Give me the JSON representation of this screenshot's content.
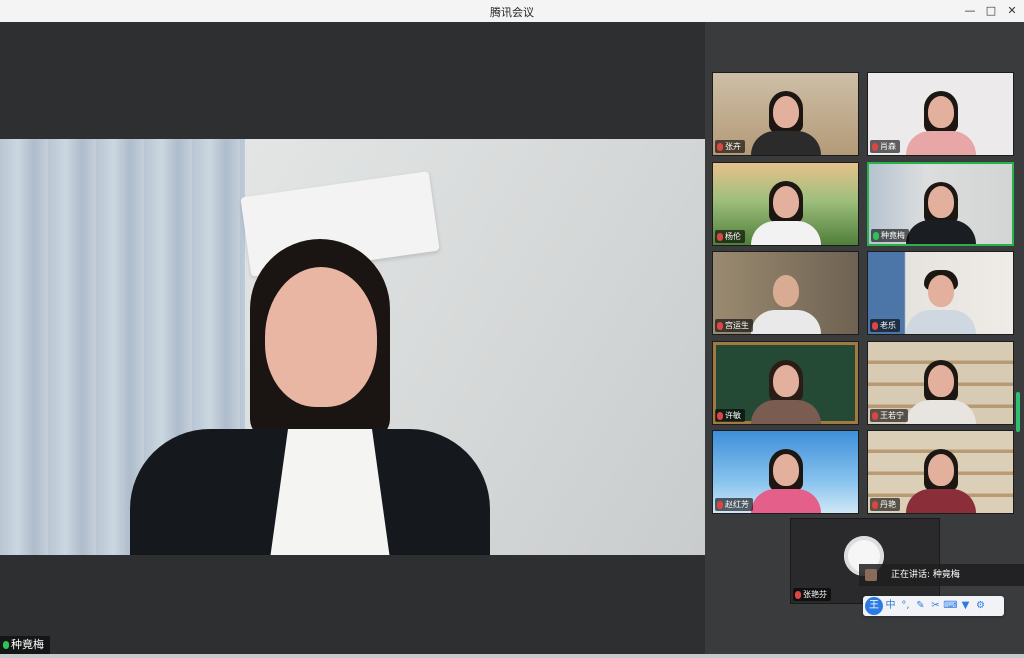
{
  "window": {
    "title": "腾讯会议",
    "controls": [
      "minimize-icon",
      "maximize-icon",
      "close-icon"
    ]
  },
  "main_speaker": {
    "name": "种竟梅",
    "mic": "on"
  },
  "participants": [
    {
      "name": "张卉",
      "mic": "muted"
    },
    {
      "name": "肖森",
      "mic": "muted",
      "host_badge": true
    },
    {
      "name": "杨伦",
      "mic": "muted"
    },
    {
      "name": "种竟梅",
      "mic": "on",
      "active_speaker": true
    },
    {
      "name": "宫运生",
      "mic": "muted"
    },
    {
      "name": "老乐",
      "mic": "muted"
    },
    {
      "name": "许敏",
      "mic": "muted"
    },
    {
      "name": "王若宁",
      "mic": "muted"
    },
    {
      "name": "赵红芳",
      "mic": "muted"
    },
    {
      "name": "丹艳",
      "mic": "muted"
    }
  ],
  "self_tile": {
    "name": "张艳芬",
    "mic": "muted"
  },
  "speaking_indicator": {
    "text": "正在讲话: 种竟梅"
  },
  "ime_toolbar": {
    "logo": "王",
    "mode": "中",
    "items": [
      "punctuation-icon",
      "pen-icon",
      "scissors-icon",
      "keyboard-icon",
      "shirt-icon",
      "gear-icon"
    ]
  },
  "colors": {
    "active_border": "#27b24a",
    "mic_on": "#2fc25b",
    "mic_muted": "#dd4444",
    "ime_blue": "#2c7be5"
  }
}
